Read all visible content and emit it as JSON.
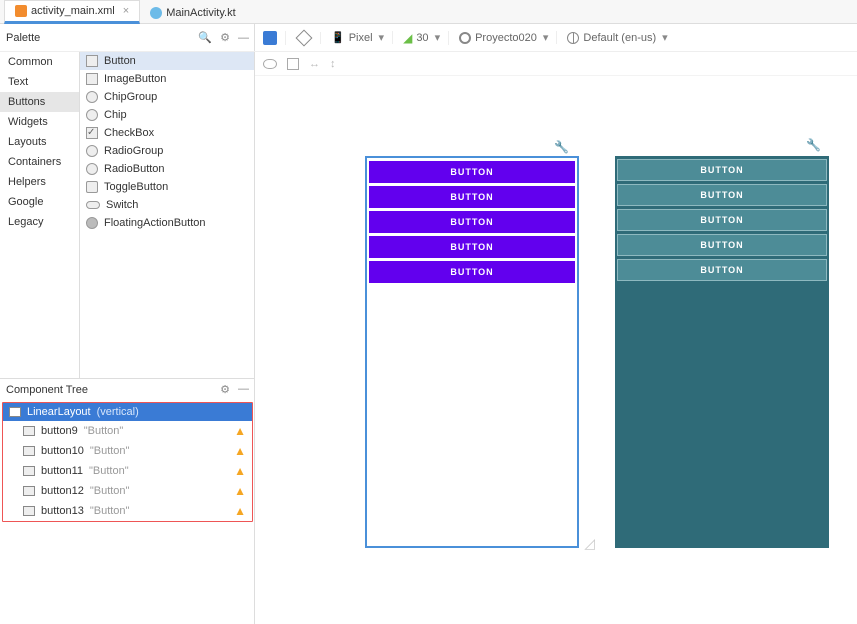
{
  "tabs": [
    {
      "label": "activity_main.xml",
      "icon": "xml",
      "active": true
    },
    {
      "label": "MainActivity.kt",
      "icon": "kt",
      "active": false
    }
  ],
  "palette": {
    "title": "Palette",
    "categories": [
      "Common",
      "Text",
      "Buttons",
      "Widgets",
      "Layouts",
      "Containers",
      "Helpers",
      "Google",
      "Legacy"
    ],
    "selected_category": "Buttons",
    "items": [
      "Button",
      "ImageButton",
      "ChipGroup",
      "Chip",
      "CheckBox",
      "RadioGroup",
      "RadioButton",
      "ToggleButton",
      "Switch",
      "FloatingActionButton"
    ],
    "selected_item": "Button"
  },
  "tree": {
    "title": "Component Tree",
    "root": {
      "name": "LinearLayout",
      "annot": "(vertical)"
    },
    "children": [
      {
        "name": "button9",
        "sub": "\"Button\""
      },
      {
        "name": "button10",
        "sub": "\"Button\""
      },
      {
        "name": "button11",
        "sub": "\"Button\""
      },
      {
        "name": "button12",
        "sub": "\"Button\""
      },
      {
        "name": "button13",
        "sub": "\"Button\""
      }
    ]
  },
  "toolbar": {
    "device": "Pixel",
    "api": "30",
    "project": "Proyecto020",
    "locale": "Default (en-us)"
  },
  "preview": {
    "buttons": [
      "BUTTON",
      "BUTTON",
      "BUTTON",
      "BUTTON",
      "BUTTON"
    ]
  }
}
